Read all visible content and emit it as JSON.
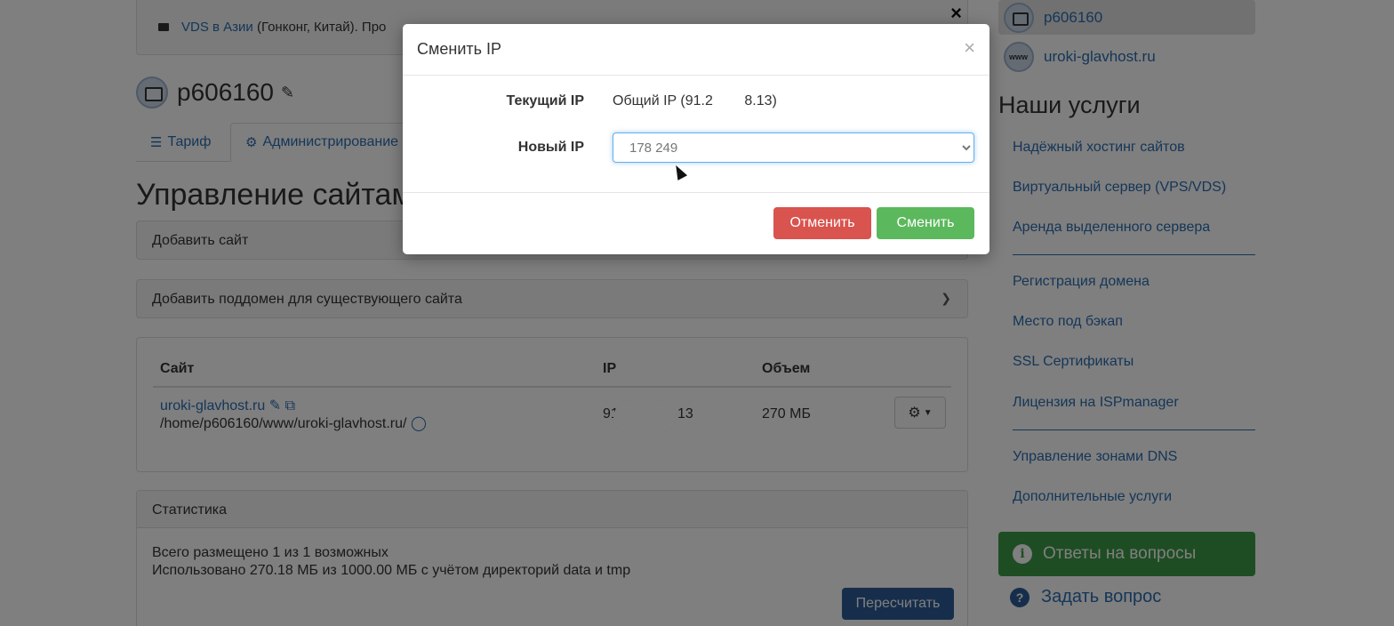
{
  "alert": {
    "link": "VDS в Азии",
    "text": "(Гонконг, Китай). Про",
    "close": "×"
  },
  "server": {
    "name": "p606160"
  },
  "tabs": [
    {
      "label": "Тариф",
      "icon": "sliders-icon"
    },
    {
      "label": "Администрирование",
      "icon": "gear-icon"
    }
  ],
  "page": {
    "heading": "Управление сайтами"
  },
  "panels": {
    "add_site": "Добавить сайт",
    "add_subdomain": "Добавить поддомен для существующего сайта"
  },
  "sites_table": {
    "headers": [
      "Сайт",
      "IP",
      "Объем"
    ],
    "rows": [
      {
        "domain": "uroki-glavhost.ru",
        "path": "/home/p606160/www/uroki-glavhost.ru/",
        "ip_start": "91",
        "ip_end": "13",
        "size": "270 МБ"
      }
    ]
  },
  "stats": {
    "title": "Статистика",
    "line1": "Всего размещено 1 из 1 возможных",
    "line2": "Использовано 270.18 МБ из 1000.00 МБ с учётом директорий data и tmp",
    "recalc": "Пересчитать"
  },
  "sidebar": {
    "accounts": [
      {
        "label": "p606160",
        "selected": true
      },
      {
        "label": "uroki-glavhost.ru",
        "selected": false
      }
    ],
    "services_title": "Наши услуги",
    "services": [
      "Надёжный хостинг сайтов",
      "Виртуальный сервер (VPS/VDS)",
      "Аренда выделенного сервера",
      "Регистрация домена",
      "Место под бэкап",
      "SSL Сертификаты",
      "Лицензия на ISPmanager",
      "Управление зонами DNS",
      "Дополнительные услуги"
    ],
    "faq": "Ответы на вопросы",
    "ask": "Задать вопрос"
  },
  "modal": {
    "title": "Сменить IP",
    "close": "×",
    "current_label": "Текущий IP",
    "current_value": "Общий IP (91.2        8.13)",
    "new_label": "Новый IP",
    "new_value": "178            249",
    "cancel": "Отменить",
    "submit": "Сменить"
  },
  "colors": {
    "link": "#2a6db0",
    "danger": "#d9534f",
    "success": "#5cb85c",
    "primary": "#2c5d97",
    "faq": "#3d9b46"
  }
}
